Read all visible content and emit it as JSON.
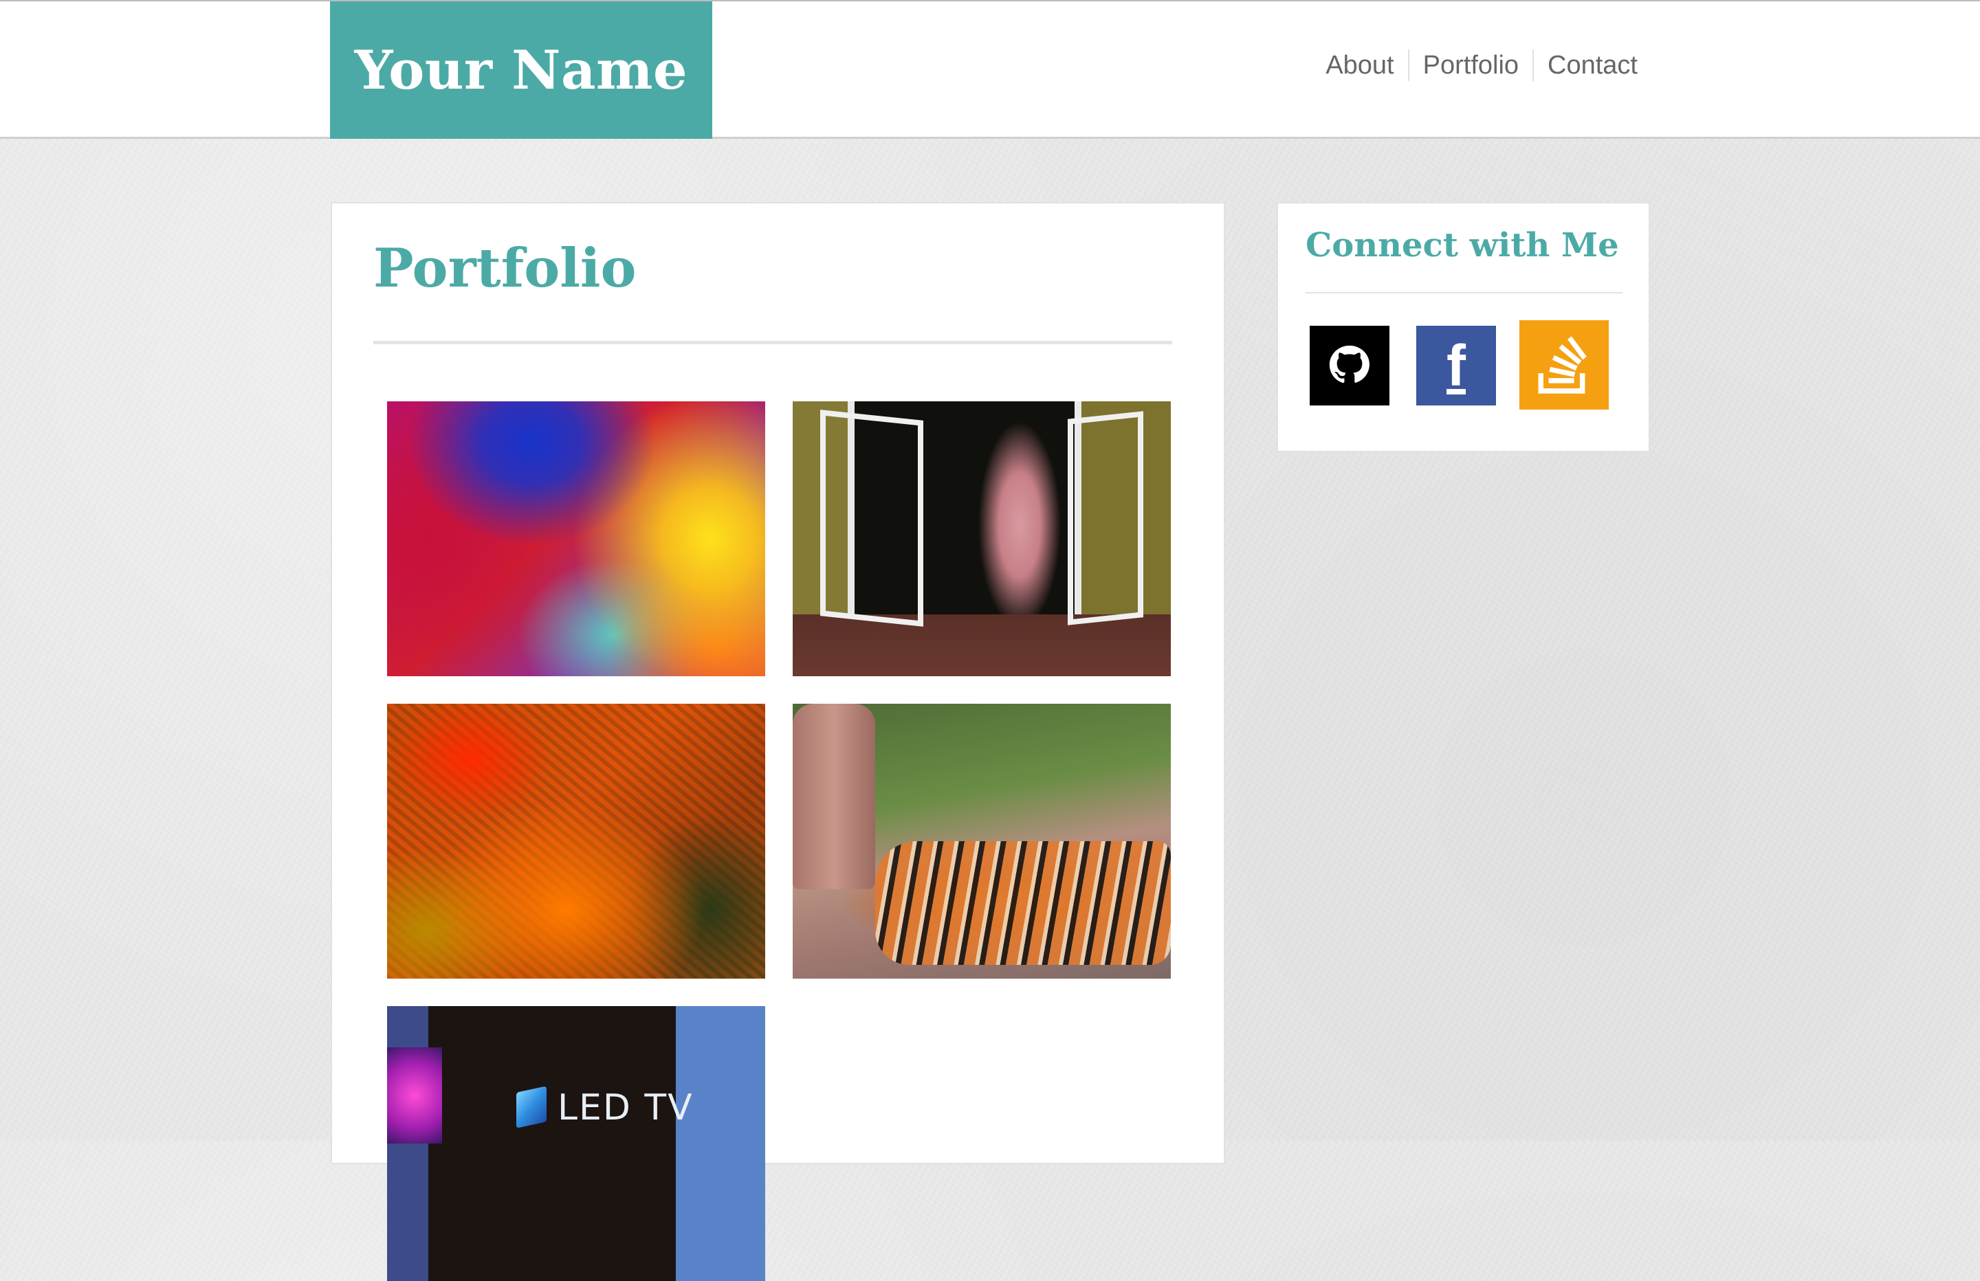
{
  "header": {
    "brand": "Your Name",
    "nav": [
      "About",
      "Portfolio",
      "Contact"
    ]
  },
  "main": {
    "title": "Portfolio",
    "gallery": [
      {
        "name": "abstract-colors"
      },
      {
        "name": "woman-in-window"
      },
      {
        "name": "orange-texture"
      },
      {
        "name": "tiger-on-wall"
      },
      {
        "name": "led-tv"
      }
    ],
    "led_tv_text": "LED TV"
  },
  "sidebar": {
    "title": "Connect with Me",
    "links": [
      {
        "icon": "github-icon",
        "label": "GitHub"
      },
      {
        "icon": "facebook-icon",
        "label": "f"
      },
      {
        "icon": "stackoverflow-icon",
        "label": "Stack Overflow"
      }
    ]
  },
  "colors": {
    "accent": "#4caaa6",
    "facebook": "#3b579d",
    "stackoverflow": "#f5a011",
    "github": "#000000"
  }
}
